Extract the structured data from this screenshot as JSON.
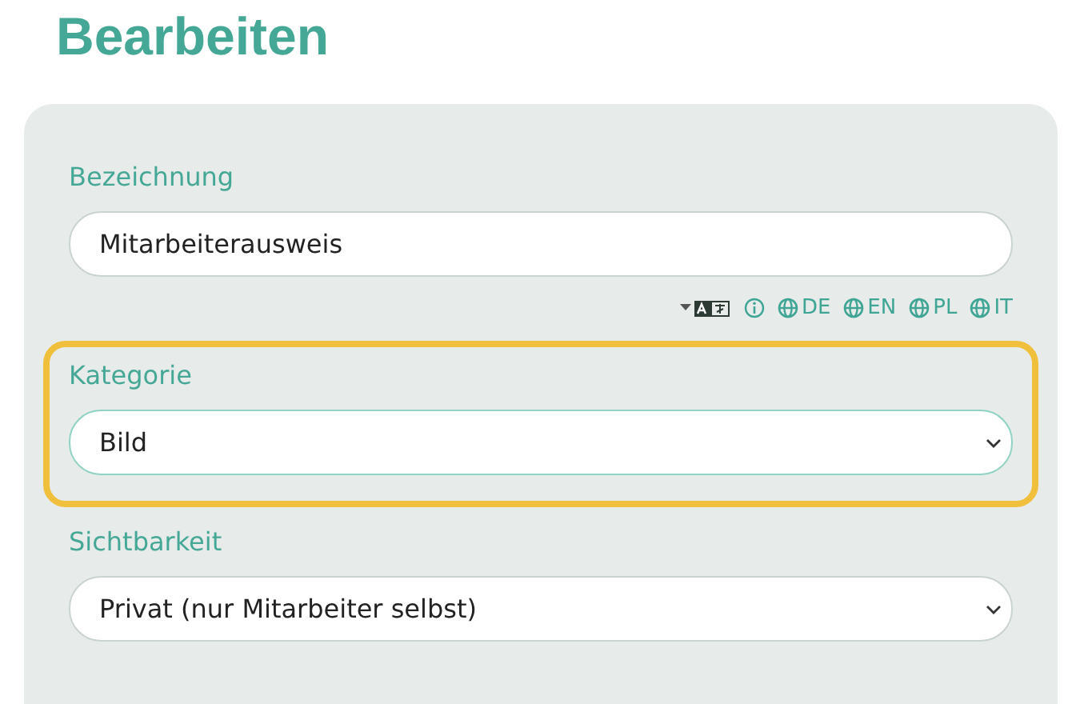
{
  "title": "Bearbeiten",
  "fields": [
    {
      "label": "Bezeichnung",
      "kind": "input",
      "value": "Mitarbeiterausweis",
      "highlighted": false,
      "languages": [
        "DE",
        "EN",
        "PL",
        "IT"
      ]
    },
    {
      "label": "Kategorie",
      "kind": "select",
      "value": "Bild",
      "highlighted": true
    },
    {
      "label": "Sichtbarkeit",
      "kind": "select",
      "value": "Privat (nur Mitarbeiter selbst)",
      "highlighted": false
    }
  ]
}
